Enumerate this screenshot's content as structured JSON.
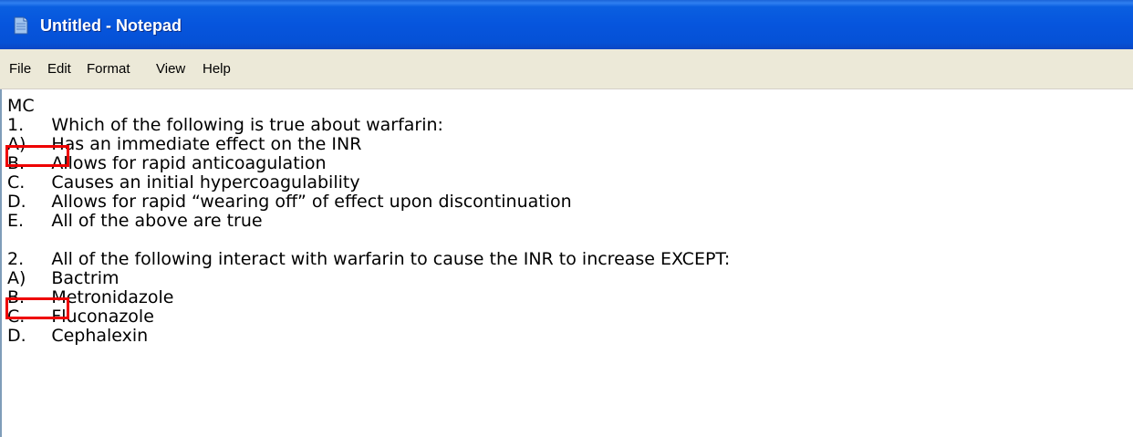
{
  "window": {
    "title": "Untitled - Notepad",
    "icon": "notepad-icon",
    "titlebar_color": "#0655dd",
    "menubar_color": "#ece9d8"
  },
  "menu": {
    "items": [
      "File",
      "Edit",
      "Format",
      "View",
      "Help"
    ]
  },
  "editor": {
    "lines": [
      "MC",
      "1.\tWhich of the following is true about warfarin:",
      "A)\tHas an immediate effect on the INR",
      "B.\tAllows for rapid anticoagulation",
      "C.\tCauses an initial hypercoagulability",
      "D.\tAllows for rapid “wearing off” of effect upon discontinuation",
      "E.\tAll of the above are true",
      "",
      "2.\tAll of the following interact with warfarin to cause the INR to increase EXCEPT:",
      "A)\tBactrim",
      "B.\tMetronidazole",
      "C.\tFluconazole",
      "D.\tCephalexin"
    ]
  },
  "annotations": {
    "highlight_color": "#ee0000"
  }
}
